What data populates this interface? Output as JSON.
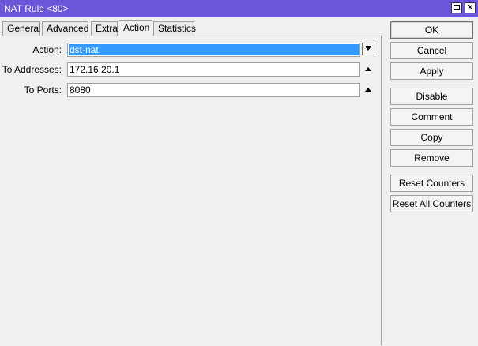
{
  "window": {
    "title": "NAT Rule <80>",
    "close_glyph": "✕"
  },
  "tabs": [
    {
      "label": "General"
    },
    {
      "label": "Advanced"
    },
    {
      "label": "Extra"
    },
    {
      "label": "Action",
      "active": true
    },
    {
      "label": "Statistics"
    }
  ],
  "form": {
    "action": {
      "label": "Action:",
      "value": "dst-nat"
    },
    "to_addresses": {
      "label": "To Addresses:",
      "value": "172.16.20.1"
    },
    "to_ports": {
      "label": "To Ports:",
      "value": "8080"
    }
  },
  "buttons": {
    "ok": "OK",
    "cancel": "Cancel",
    "apply": "Apply",
    "disable": "Disable",
    "comment": "Comment",
    "copy": "Copy",
    "remove": "Remove",
    "reset_counters": "Reset Counters",
    "reset_all_counters": "Reset All Counters"
  },
  "colors": {
    "titlebar": "#6b55d9",
    "selection": "#3399ff"
  }
}
